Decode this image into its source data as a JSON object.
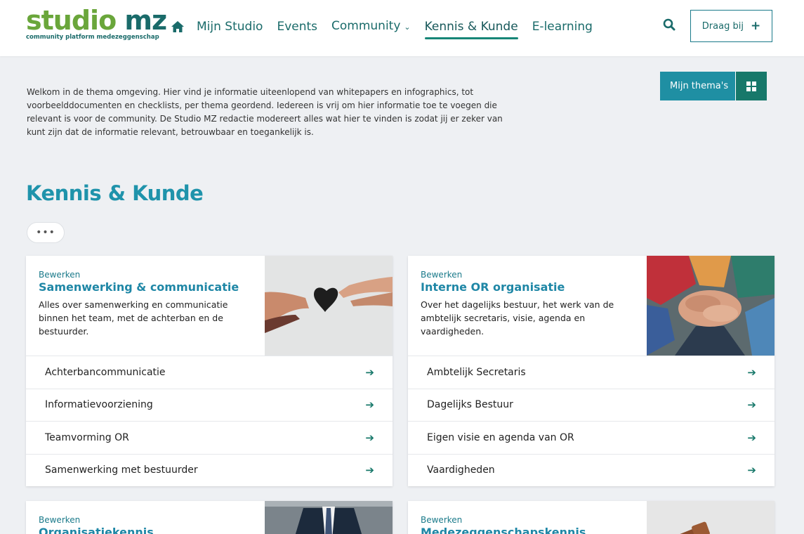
{
  "header": {
    "logo_main_1": "studio",
    "logo_main_2": "mz",
    "logo_sub": "community platform medezeggenschap",
    "nav": [
      "Mijn Studio",
      "Events",
      "Community",
      "Kennis & Kunde",
      "E-learning"
    ],
    "community_chevron": "⌄",
    "cta_label": "Draag bij",
    "cta_icon": "+"
  },
  "toolbar": {
    "mijn_themas": "Mijn thema's"
  },
  "intro": "Welkom in de thema omgeving. Hier vind je informatie uiteenlopend van whitepapers en infographics, tot voorbeelddocumenten en checklists, per thema geordend. Iedereen is vrij om hier informatie toe te voegen die relevant is voor de community. De Studio MZ redactie modereert alles wat hier te vinden is zodat jij er zeker van kunt zijn dat de informatie relevant, betrouwbaar en toegankelijk is.",
  "page_title": "Kennis & Kunde",
  "more_label": "•••",
  "cards": [
    {
      "edit": "Bewerken",
      "title": "Samenwerking & communicatie",
      "desc": "Alles over samenwerking en communicatie binnen het team, met de achterban en de bestuurder.",
      "rows": [
        "Achterbancommunicatie",
        "Informatievoorziening",
        "Teamvorming OR",
        "Samenwerking met bestuurder"
      ]
    },
    {
      "edit": "Bewerken",
      "title": "Interne OR organisatie",
      "desc": "Over het dagelijks bestuur, het werk van de ambtelijk secretaris, visie, agenda en vaardigheden.",
      "rows": [
        "Ambtelijk Secretaris",
        "Dagelijks Bestuur",
        "Eigen visie en agenda van OR",
        "Vaardigheden"
      ]
    },
    {
      "edit": "Bewerken",
      "title": "Organisatiekennis"
    },
    {
      "edit": "Bewerken",
      "title": "Medezeggenschapskennis"
    }
  ],
  "row_arrow": "➔",
  "colors": {
    "brand_teal": "#1a6b6a",
    "brand_green": "#6aa63b",
    "accent_blue": "#1f93ab",
    "button_teal": "#1f8fa3",
    "button_green": "#17786a"
  },
  "icons": [
    "home-icon",
    "chevron-down-icon",
    "search-icon",
    "plus-icon",
    "grid-icon",
    "arrow-right-icon"
  ]
}
